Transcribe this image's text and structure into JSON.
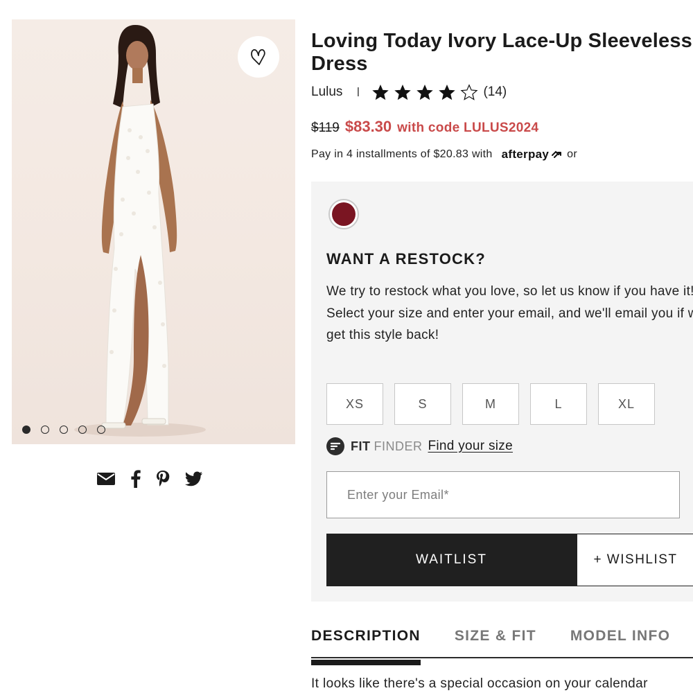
{
  "gallery": {
    "image_alt": "Model wearing ivory lace dress",
    "slide_count": 5,
    "active_slide": 1,
    "favorite_icon": "heart-icon"
  },
  "share": {
    "icons": [
      "email-icon",
      "facebook-icon",
      "pinterest-icon",
      "twitter-icon"
    ]
  },
  "product": {
    "title": "Loving Today Ivory Lace-Up Sleeveless Dress",
    "brand": "Lulus",
    "separator": "I",
    "rating": 4,
    "rating_max": 5,
    "review_count": "(14)",
    "old_price": "$119",
    "sale_price": "$83.30",
    "promo": "with code LULUS2024",
    "installments": "Pay in 4 installments of $20.83 with",
    "afterpay_logo": "afterpay",
    "or_text": "or"
  },
  "restock": {
    "swatch_color": "#7a1522",
    "heading": "WANT A RESTOCK?",
    "line1": "We try to restock what you love, so let us know if you have it!",
    "line2": "Select your size and enter your email, and we'll email you if we get this style back!",
    "sizes": [
      "XS",
      "S",
      "M",
      "L",
      "XL"
    ],
    "fit_strong": "FIT",
    "fit_light": "FINDER",
    "fit_link": "Find your size",
    "email_placeholder": "Enter your Email*",
    "waitlist_label": "WAITLIST",
    "wishlist_label": "+ WISHLIST"
  },
  "tabs": {
    "items": [
      "DESCRIPTION",
      "SIZE & FIT",
      "MODEL INFO"
    ],
    "active": "DESCRIPTION"
  },
  "description": {
    "text": "It looks like there's a special occasion on your calendar"
  },
  "colors": {
    "sale_red": "#c94a4a",
    "button_dark": "#202020",
    "panel_bg": "#f4f4f4"
  }
}
